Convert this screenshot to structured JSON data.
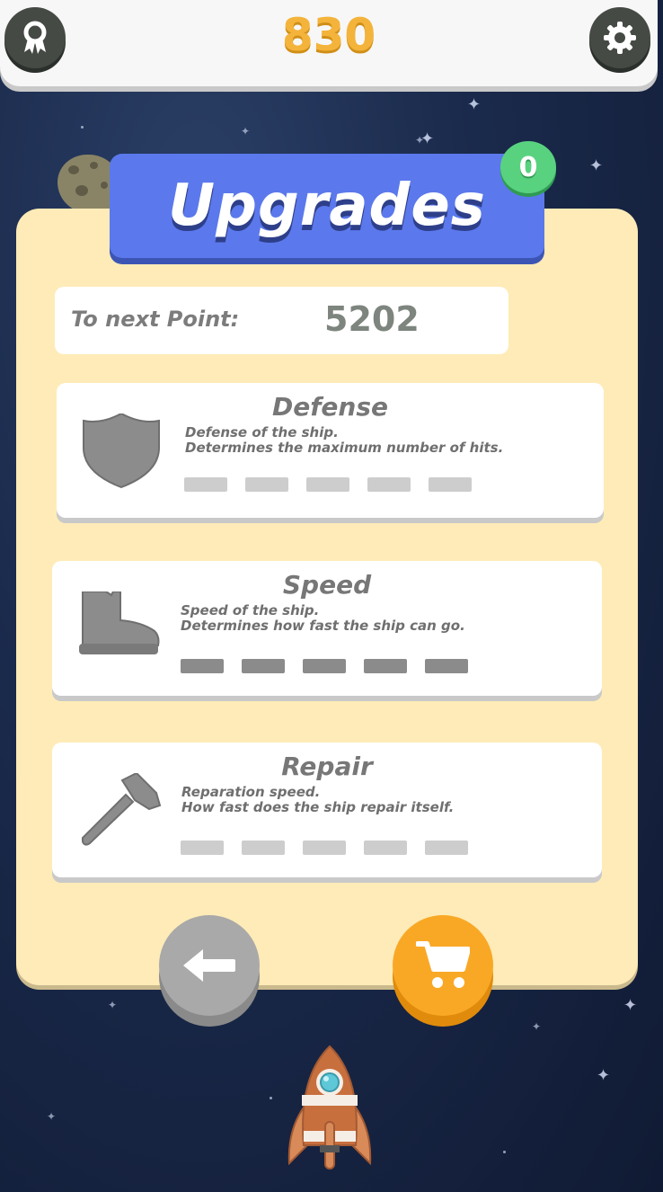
{
  "header": {
    "score": "830",
    "achievements_icon": "ribbon-icon",
    "settings_icon": "gear-icon"
  },
  "title": {
    "text": "Upgrades",
    "available_points": "0"
  },
  "next_point": {
    "label": "To next Point:",
    "value": "5202"
  },
  "upgrades": [
    {
      "name": "Defense",
      "icon": "shield-icon",
      "description_line1": "Defense of the ship.",
      "description_line2": "Determines the maximum number of hits.",
      "level": 0,
      "max_level": 5
    },
    {
      "name": "Speed",
      "icon": "boot-icon",
      "description_line1": "Speed of the ship.",
      "description_line2": "Determines how fast the ship can go.",
      "level": 5,
      "max_level": 5
    },
    {
      "name": "Repair",
      "icon": "hammer-icon",
      "description_line1": "Reparation speed.",
      "description_line2": "How fast does the ship repair itself.",
      "level": 0,
      "max_level": 5
    }
  ],
  "buttons": {
    "back_icon": "arrow-left-icon",
    "shop_icon": "cart-icon"
  },
  "colors": {
    "score": "#f4b33a",
    "banner": "#5b79ec",
    "badge": "#59d27f",
    "panel": "#feebb7",
    "shop_button": "#f9a826",
    "back_button": "#a9a9a9"
  }
}
